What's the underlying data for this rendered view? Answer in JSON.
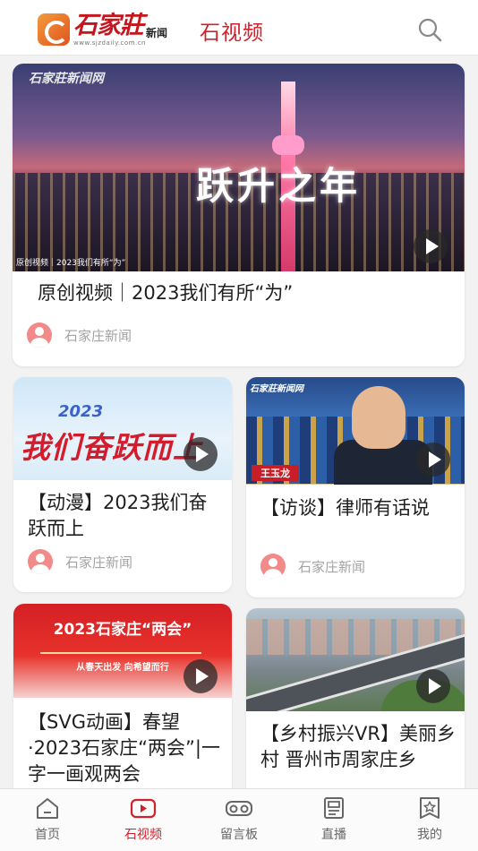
{
  "header": {
    "brand": "石家莊",
    "brand_sub": "新闻",
    "brand_url": "www.sjzdaily.com.cn",
    "channel_title": "石视频",
    "icons": {
      "search": "search-icon",
      "logo": "logo-emblem-icon"
    }
  },
  "feed": [
    {
      "title": "原创视频｜2023我们有所“为”",
      "source": "石家庄新闻",
      "thumbnail": {
        "watermark": "石家莊新闻网",
        "overlay_text": "跃升之年",
        "caption": "原创视频｜2023我们有所“为”"
      }
    },
    {
      "title": "【动漫】2023我们奋跃而上",
      "source": "石家庄新闻",
      "thumbnail": {
        "year": "2023",
        "art_text": "我们奋跃而上"
      }
    },
    {
      "title": "【访谈】律师有话说",
      "source": "石家庄新闻",
      "thumbnail": {
        "watermark": "石家莊新闻网",
        "nameplate": "王玉龙"
      }
    },
    {
      "title": "【SVG动画】春望·2023石家庄“两会”|一字一画观两会",
      "thumbnail": {
        "header_text": "2023石家庄“两会”",
        "slogan": "从春天出发 向希望而行"
      }
    },
    {
      "title": "【乡村振兴VR】美丽乡村 晋州市周家庄乡"
    }
  ],
  "tabbar": [
    {
      "label": "首页",
      "icon": "home-icon",
      "active": false
    },
    {
      "label": "石视频",
      "icon": "video-play-icon",
      "active": true
    },
    {
      "label": "留言板",
      "icon": "vr-glasses-icon",
      "active": false
    },
    {
      "label": "直播",
      "icon": "live-news-icon",
      "active": false
    },
    {
      "label": "我的",
      "icon": "profile-star-icon",
      "active": false
    }
  ],
  "colors": {
    "accent": "#d1212b",
    "background": "#f2f2f2",
    "secondary_text": "#a3a3a3"
  }
}
